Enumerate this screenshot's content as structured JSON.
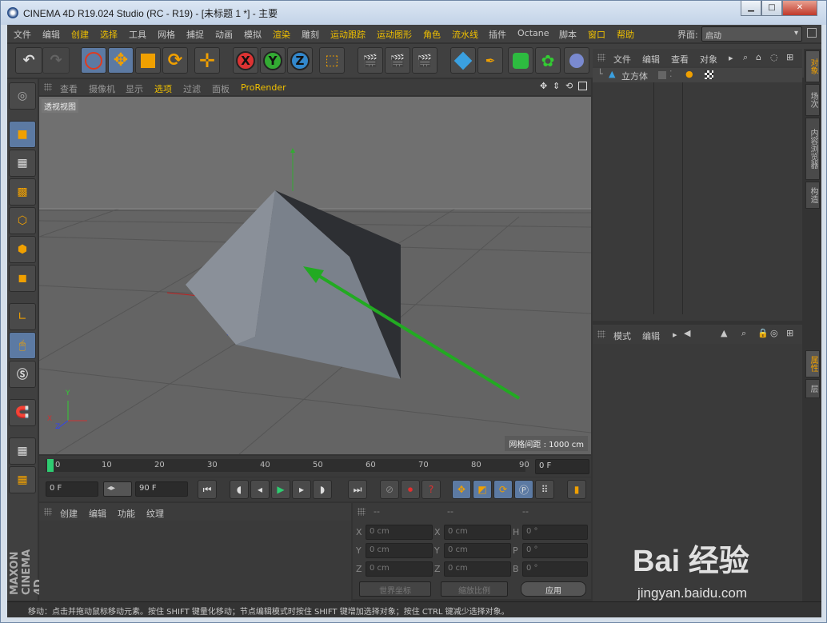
{
  "window": {
    "title": "CINEMA 4D R19.024 Studio (RC - R19) - [未标题 1 *] - 主要",
    "minimize": "▁",
    "maximize": "□",
    "close": "✕"
  },
  "menu": {
    "items": [
      "文件",
      "编辑",
      "创建",
      "选择",
      "工具",
      "网格",
      "捕捉",
      "动画",
      "模拟",
      "渲染",
      "雕刻",
      "运动跟踪",
      "运动图形",
      "角色",
      "流水线",
      "插件",
      "Octane",
      "脚本",
      "窗口",
      "帮助"
    ],
    "layout_label": "界面:",
    "layout_value": "启动"
  },
  "toolbar": {
    "axis_x": "X",
    "axis_y": "Y",
    "axis_z": "Z"
  },
  "viewport": {
    "menu": [
      "查看",
      "摄像机",
      "显示",
      "选项",
      "过滤",
      "面板",
      "ProRender"
    ],
    "view_name": "透视视图",
    "grid_spacing": "网格间距 : 1000 cm",
    "axis_labels": {
      "x": "X",
      "y": "Y",
      "z": "Z"
    }
  },
  "timeline": {
    "ticks": [
      "0",
      "10",
      "20",
      "30",
      "40",
      "50",
      "60",
      "70",
      "80",
      "90"
    ],
    "current_frame": "0 F"
  },
  "transport": {
    "start": "0 F",
    "end": "90 F"
  },
  "material_panel": {
    "menu": [
      "创建",
      "编辑",
      "功能",
      "纹理"
    ]
  },
  "coord_panel": {
    "headers": [
      "--",
      "--",
      "--"
    ],
    "rows": [
      {
        "a": "X",
        "av": "0 cm",
        "b": "X",
        "bv": "0 cm",
        "c": "H",
        "cv": "0 °"
      },
      {
        "a": "Y",
        "av": "0 cm",
        "b": "Y",
        "bv": "0 cm",
        "c": "P",
        "cv": "0 °"
      },
      {
        "a": "Z",
        "av": "0 cm",
        "b": "Z",
        "bv": "0 cm",
        "c": "B",
        "cv": "0 °"
      }
    ],
    "world_coords": "世界坐标",
    "scale": "缩放比例",
    "apply": "应用"
  },
  "object_panel": {
    "menu": [
      "文件",
      "编辑",
      "查看",
      "对象"
    ],
    "object_name": "立方体"
  },
  "attr_panel": {
    "menu": [
      "模式",
      "编辑"
    ]
  },
  "right_tabs": [
    "对象",
    "场次",
    "内容浏览器",
    "构造",
    "属性",
    "层"
  ],
  "logo": "MAXON CINEMA 4D",
  "status": "移动：点击并拖动鼠标移动元素。按住 SHIFT 键量化移动；节点编辑模式时按住 SHIFT 键增加选择对象；按住 CTRL 键减少选择对象。",
  "watermark": {
    "brand": "Bai 经验",
    "url": "jingyan.baidu.com"
  },
  "colors": {
    "accent": "#f0a000",
    "arrow": "#22aa22",
    "menu_highlight": "#f0c000"
  }
}
